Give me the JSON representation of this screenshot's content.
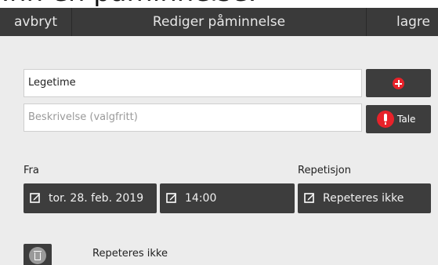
{
  "heading": {
    "text": "Inn en påminnelse:"
  },
  "toolbar": {
    "cancel_label": "avbryt",
    "title": "Rediger påminnelse",
    "save_label": "lagre"
  },
  "form": {
    "title_value": "Legetime",
    "description_placeholder": "Beskrivelse (valgfritt)",
    "speak_label": "Tale"
  },
  "schedule": {
    "from_label": "Fra",
    "repeat_label": "Repetisjon",
    "date_value": "tor. 28. feb. 2019",
    "time_value": "14:00",
    "repeat_value": "Repeteres ikke"
  },
  "list": {
    "repeat_text": "Repeteres ikke"
  },
  "colors": {
    "accent_red": "#e8222a",
    "bar_dark": "#3a3a3a",
    "button_dark": "#3d3d3d"
  },
  "icons": {
    "add": "plus-circle-icon",
    "speak": "microphone-icon",
    "edit": "edit-icon",
    "delete": "trash-icon"
  }
}
